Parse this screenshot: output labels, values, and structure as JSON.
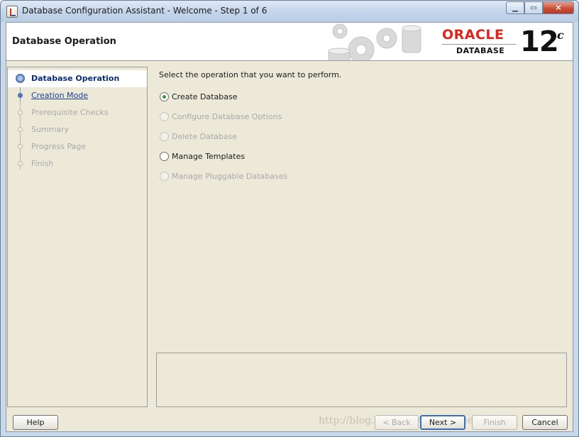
{
  "window": {
    "title": "Database Configuration Assistant - Welcome - Step 1 of 6",
    "controls": {
      "minimize": "▁",
      "maximize": "▭",
      "close": "✕"
    }
  },
  "header": {
    "title": "Database Operation",
    "brand": {
      "oracle": "ORACLE",
      "database": "DATABASE",
      "version": "12",
      "version_suffix": "c",
      "oracle_color": "#e2231a"
    }
  },
  "steps": [
    {
      "label": "Database Operation",
      "state": "current"
    },
    {
      "label": "Creation Mode",
      "state": "link"
    },
    {
      "label": "Prerequisite Checks",
      "state": "disabled"
    },
    {
      "label": "Summary",
      "state": "disabled"
    },
    {
      "label": "Progress Page",
      "state": "disabled"
    },
    {
      "label": "Finish",
      "state": "disabled"
    }
  ],
  "content": {
    "instruction": "Select the operation that you want to perform.",
    "options": [
      {
        "label": "Create Database",
        "selected": true,
        "enabled": true
      },
      {
        "label": "Configure Database Options",
        "selected": false,
        "enabled": false
      },
      {
        "label": "Delete Database",
        "selected": false,
        "enabled": false
      },
      {
        "label": "Manage Templates",
        "selected": false,
        "enabled": true
      },
      {
        "label": "Manage Pluggable Databases",
        "selected": false,
        "enabled": false
      }
    ]
  },
  "buttons": {
    "help": "Help",
    "back": "< Back",
    "next": "Next >",
    "finish": "Finish",
    "cancel": "Cancel"
  },
  "watermark": "http://blog.csdn.net/rumbleseed"
}
